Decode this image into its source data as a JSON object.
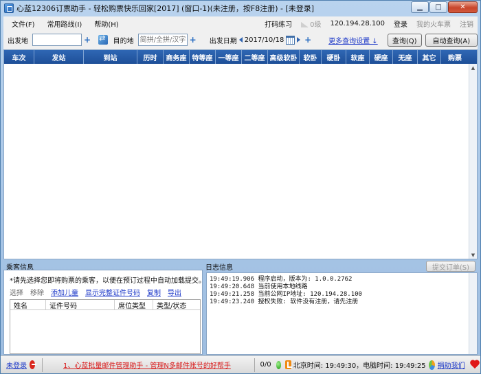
{
  "window": {
    "title": "心蓝12306订票助手 - 轻松购票快乐回家[2017] (窗口-1)(未注册，按F8注册) - [未登录]",
    "min_glyph": "▁",
    "max_glyph": "□",
    "close_glyph": "✕"
  },
  "menu": {
    "file": "文件(F)",
    "routes": "常用路线(I)",
    "help": "帮助(H)",
    "captcha": "打码练习",
    "level": "0级",
    "ip": "120.194.28.100",
    "login": "登录",
    "my_tickets": "我的火车票",
    "logout": "注销"
  },
  "query": {
    "from_label": "出发地",
    "from_value": "",
    "to_label": "目的地",
    "to_placeholder": "简拼/全拼/汉字",
    "date_label": "出发日期",
    "date_value": "2017/10/18",
    "more_settings": "更多查询设置 ↓",
    "search_btn": "查询(Q)",
    "auto_search_btn": "自动查询(A)",
    "plus": "+"
  },
  "grid": {
    "columns": [
      "车次",
      "发站",
      "到站",
      "历时",
      "商务座",
      "特等座",
      "一等座",
      "二等座",
      "高级软卧",
      "软卧",
      "硬卧",
      "软座",
      "硬座",
      "无座",
      "其它",
      "购票"
    ],
    "scroll_up": "▲",
    "scroll_down": "▼"
  },
  "passenger": {
    "title": "乘客信息",
    "hint": "*请先选择您即将购票的乘客，以便在预订过程中自动加载提交。",
    "select": "选择",
    "remove": "移除",
    "add_child": "添加儿童",
    "show_full_id": "显示完整证件号码",
    "copy": "复制",
    "export": "导出",
    "columns": [
      "姓名",
      "证件号码",
      "席位类型",
      "类型/状态"
    ]
  },
  "log": {
    "title": "日志信息",
    "submit_btn": "提交订单(S)",
    "lines": [
      "19:49:19.906 程序启动，版本为: 1.0.0.2762",
      "19:49:20.648 当前使用本地线路",
      "19:49:21.258 当前公网IP地址: 120.194.28.100",
      "19:49:23.240 授权失败: 软件没有注册，请先注册"
    ]
  },
  "status": {
    "login_status": "未登录",
    "ad_text": "1、心蓝批量邮件管理助手 - 管理N多邮件账号的好帮手",
    "count": "0/0",
    "beijing_time": "北京时间: 19:49:30，电脑时间: 19:49:25",
    "donate": "捐助我们"
  }
}
